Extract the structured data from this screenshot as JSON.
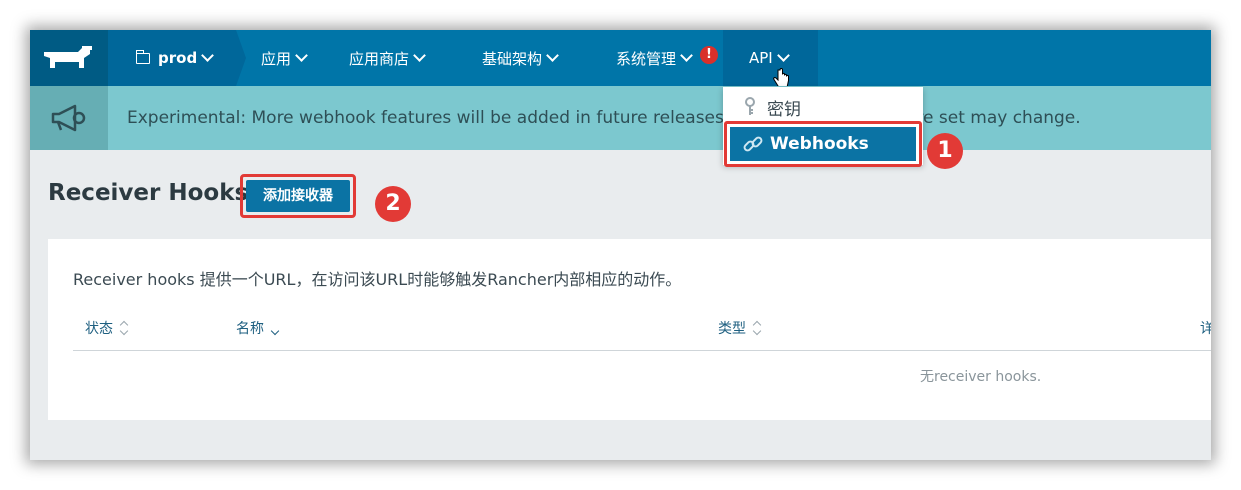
{
  "nav": {
    "env_label": "prod",
    "items": [
      {
        "label": "应用"
      },
      {
        "label": "应用商店"
      },
      {
        "label": "基础架构"
      },
      {
        "label": "系统管理"
      },
      {
        "label": "API"
      }
    ],
    "alert_badge": "!"
  },
  "dropdown": {
    "items": [
      {
        "label": "密钥",
        "icon": "key-icon"
      },
      {
        "label": "Webhooks",
        "icon": "link-icon"
      }
    ]
  },
  "banner": {
    "text": "Experimental: More webhook features will be added in future releases, and the current feature set may change.",
    "icon": "megaphone-icon"
  },
  "page": {
    "title": "Receiver Hooks",
    "add_button": "添加接收器"
  },
  "steps": {
    "one": "1",
    "two": "2"
  },
  "card": {
    "description": "Receiver hooks 提供一个URL，在访问该URL时能够触发Rancher内部相应的动作。",
    "columns": [
      "状态",
      "名称",
      "类型",
      "详"
    ],
    "empty_text": "无receiver hooks."
  },
  "colors": {
    "nav_bg": "#0075a8",
    "banner_bg": "#7cc8cf",
    "accent_red": "#e23a36",
    "primary_button": "#0b73a4"
  }
}
